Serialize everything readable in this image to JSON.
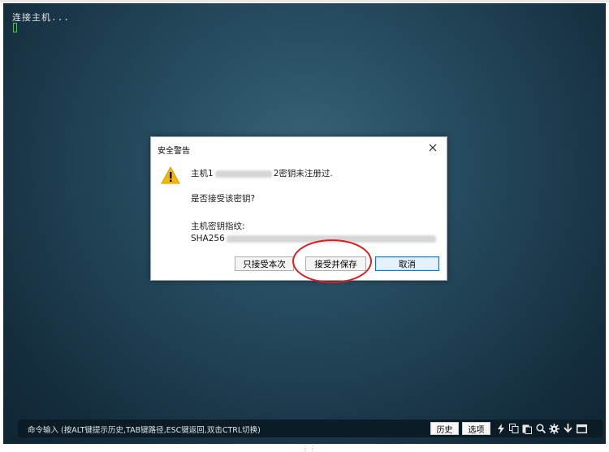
{
  "terminal": {
    "status_line": "连接主机...",
    "background": "#1f3f52"
  },
  "dialog": {
    "title": "安全警告",
    "close_icon": "close-icon",
    "warning_icon": "warning-triangle-icon",
    "line1_prefix": "主机1",
    "line1_suffix": "2密钥未注册过.",
    "line2": "是否接受该密钥?",
    "line3": "主机密钥指纹:",
    "line4_prefix": "SHA256",
    "buttons": {
      "accept_once": "只接受本次",
      "accept_save": "接受并保存",
      "cancel": "取消"
    }
  },
  "annotation": {
    "highlight_color": "#d9201e"
  },
  "statusbar": {
    "command_label": "命令输入 (按ALT键提示历史,TAB键路径,ESC键返回,双击CTRL切换)",
    "history_button": "历史",
    "options_button": "选项",
    "icons": [
      "lightning-icon",
      "copy-icon",
      "paste-icon",
      "search-icon",
      "gear-icon",
      "arrow-down-icon",
      "window-icon"
    ]
  }
}
